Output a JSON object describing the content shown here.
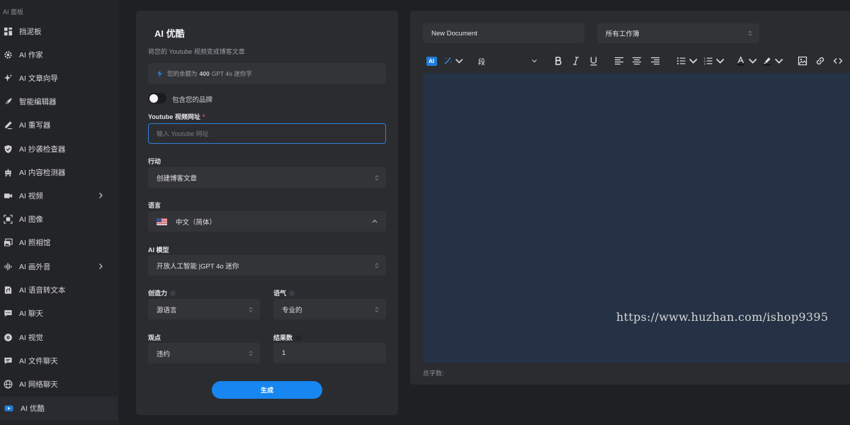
{
  "sidebar": {
    "header": "AI 面板",
    "items": [
      {
        "label": "挡泥板",
        "icon": "dashboard-icon"
      },
      {
        "label": "AI 作家",
        "icon": "gear-icon"
      },
      {
        "label": "AI 文章向导",
        "icon": "sparkle-icon"
      },
      {
        "label": "智能编辑器",
        "icon": "feather-icon"
      },
      {
        "label": "AI 重写器",
        "icon": "pencil-icon"
      },
      {
        "label": "AI 抄袭检查器",
        "icon": "shield-icon"
      },
      {
        "label": "AI 内容检测器",
        "icon": "robot-icon"
      },
      {
        "label": "AI 视频",
        "icon": "video-icon"
      },
      {
        "label": "AI 图像",
        "icon": "image-scan-icon"
      },
      {
        "label": "AI 照相馆",
        "icon": "gallery-icon"
      },
      {
        "label": "AI 画外音",
        "icon": "waveform-icon"
      },
      {
        "label": "AI 语音转文本",
        "icon": "audio-file-icon"
      },
      {
        "label": "AI 聊天",
        "icon": "chat-icon"
      },
      {
        "label": "AI 视觉",
        "icon": "eye-icon"
      },
      {
        "label": "AI 文件聊天",
        "icon": "file-chat-icon"
      },
      {
        "label": "AI 网络聊天",
        "icon": "globe-icon"
      },
      {
        "label": "AI 优酷",
        "icon": "youtube-icon"
      }
    ]
  },
  "form": {
    "title": "AI 优酷",
    "subtitle": "将您的 Youtube 视频变成博客文章",
    "balance_prefix": "您的余额为",
    "balance_value": "400",
    "balance_suffix": "GPT 4o 迷你字",
    "brand_toggle_label": "包含您的品牌",
    "url_label": "Youtube 视频网址",
    "url_required_mark": "*",
    "url_placeholder": "输入 Youtube 网址",
    "action_label": "行动",
    "action_value": "创建博客文章",
    "language_label": "语言",
    "language_value": "中文（简体）",
    "model_label": "AI 模型",
    "model_value": "开放人工智能 |GPT 4o 迷你",
    "creativity_label": "创造力",
    "creativity_value": "源语言",
    "tone_label": "语气",
    "tone_value": "专业的",
    "pov_label": "观点",
    "pov_value": "违约",
    "results_label": "结果数",
    "results_value": "1",
    "generate_label": "生成"
  },
  "editor": {
    "document_name": "New Document",
    "workbook_value": "所有工作簿",
    "ai_badge": "AI",
    "paragraph_value": "段",
    "word_count_label": "总字数:",
    "watermark": "https://www.huzhan.com/ishop9395"
  },
  "colors": {
    "accent": "#1786f0",
    "editor_background": "#253245",
    "panel": "#2b2c30",
    "page": "#1f2023"
  }
}
